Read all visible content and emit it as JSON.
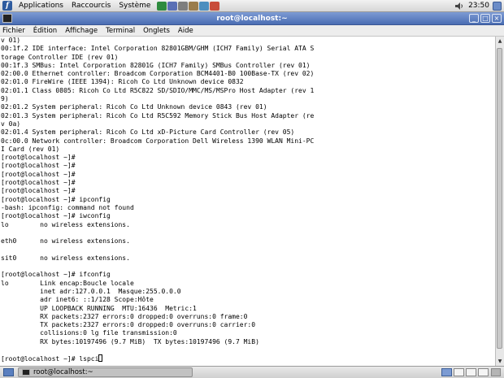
{
  "top_panel": {
    "menus": [
      "Applications",
      "Raccourcis",
      "Système"
    ],
    "clock": "23:50",
    "launcher_colors": [
      "#2e8b3e",
      "#5a6fb5",
      "#7e7e7e",
      "#9a7c4c",
      "#4c8fbf",
      "#c84c3a"
    ]
  },
  "window": {
    "title": "root@localhost:~",
    "buttons": {
      "minimize": "_",
      "maximize": "□",
      "close": "×"
    }
  },
  "menubar": {
    "items": [
      "Fichier",
      "Édition",
      "Affichage",
      "Terminal",
      "Onglets",
      "Aide"
    ]
  },
  "terminal": {
    "lines": [
      "v 01)",
      "00:1f.2 IDE interface: Intel Corporation 82801GBM/GHM (ICH7 Family) Serial ATA S",
      "torage Controller IDE (rev 01)",
      "00:1f.3 SMBus: Intel Corporation 82801G (ICH7 Family) SMBus Controller (rev 01)",
      "02:00.0 Ethernet controller: Broadcom Corporation BCM4401-B0 100Base-TX (rev 02)",
      "02:01.0 FireWire (IEEE 1394): Ricoh Co Ltd Unknown device 0832",
      "02:01.1 Class 0805: Ricoh Co Ltd R5C822 SD/SDIO/MMC/MS/MSPro Host Adapter (rev 1",
      "9)",
      "02:01.2 System peripheral: Ricoh Co Ltd Unknown device 0843 (rev 01)",
      "02:01.3 System peripheral: Ricoh Co Ltd R5C592 Memory Stick Bus Host Adapter (re",
      "v 0a)",
      "02:01.4 System peripheral: Ricoh Co Ltd xD-Picture Card Controller (rev 05)",
      "0c:00.0 Network controller: Broadcom Corporation Dell Wireless 1390 WLAN Mini-PC",
      "I Card (rev 01)",
      "[root@localhost ~]#",
      "[root@localhost ~]#",
      "[root@localhost ~]#",
      "[root@localhost ~]#",
      "[root@localhost ~]#",
      "[root@localhost ~]# ipconfig",
      "-bash: ipconfig: command not found",
      "[root@localhost ~]# iwconfig",
      "lo        no wireless extensions.",
      "",
      "eth0      no wireless extensions.",
      "",
      "sit0      no wireless extensions.",
      "",
      "[root@localhost ~]# ifconfig",
      "lo        Link encap:Boucle locale",
      "          inet adr:127.0.0.1  Masque:255.0.0.0",
      "          adr inet6: ::1/128 Scope:Hôte",
      "          UP LOOPBACK RUNNING  MTU:16436  Metric:1",
      "          RX packets:2327 errors:0 dropped:0 overruns:0 frame:0",
      "          TX packets:2327 errors:0 dropped:0 overruns:0 carrier:0",
      "          collisions:0 lg file transmission:0",
      "          RX bytes:10197496 (9.7 MiB)  TX bytes:10197496 (9.7 MiB)",
      ""
    ],
    "prompt": "[root@localhost ~]# lspci"
  },
  "taskbar": {
    "task_label": "root@localhost:~"
  }
}
